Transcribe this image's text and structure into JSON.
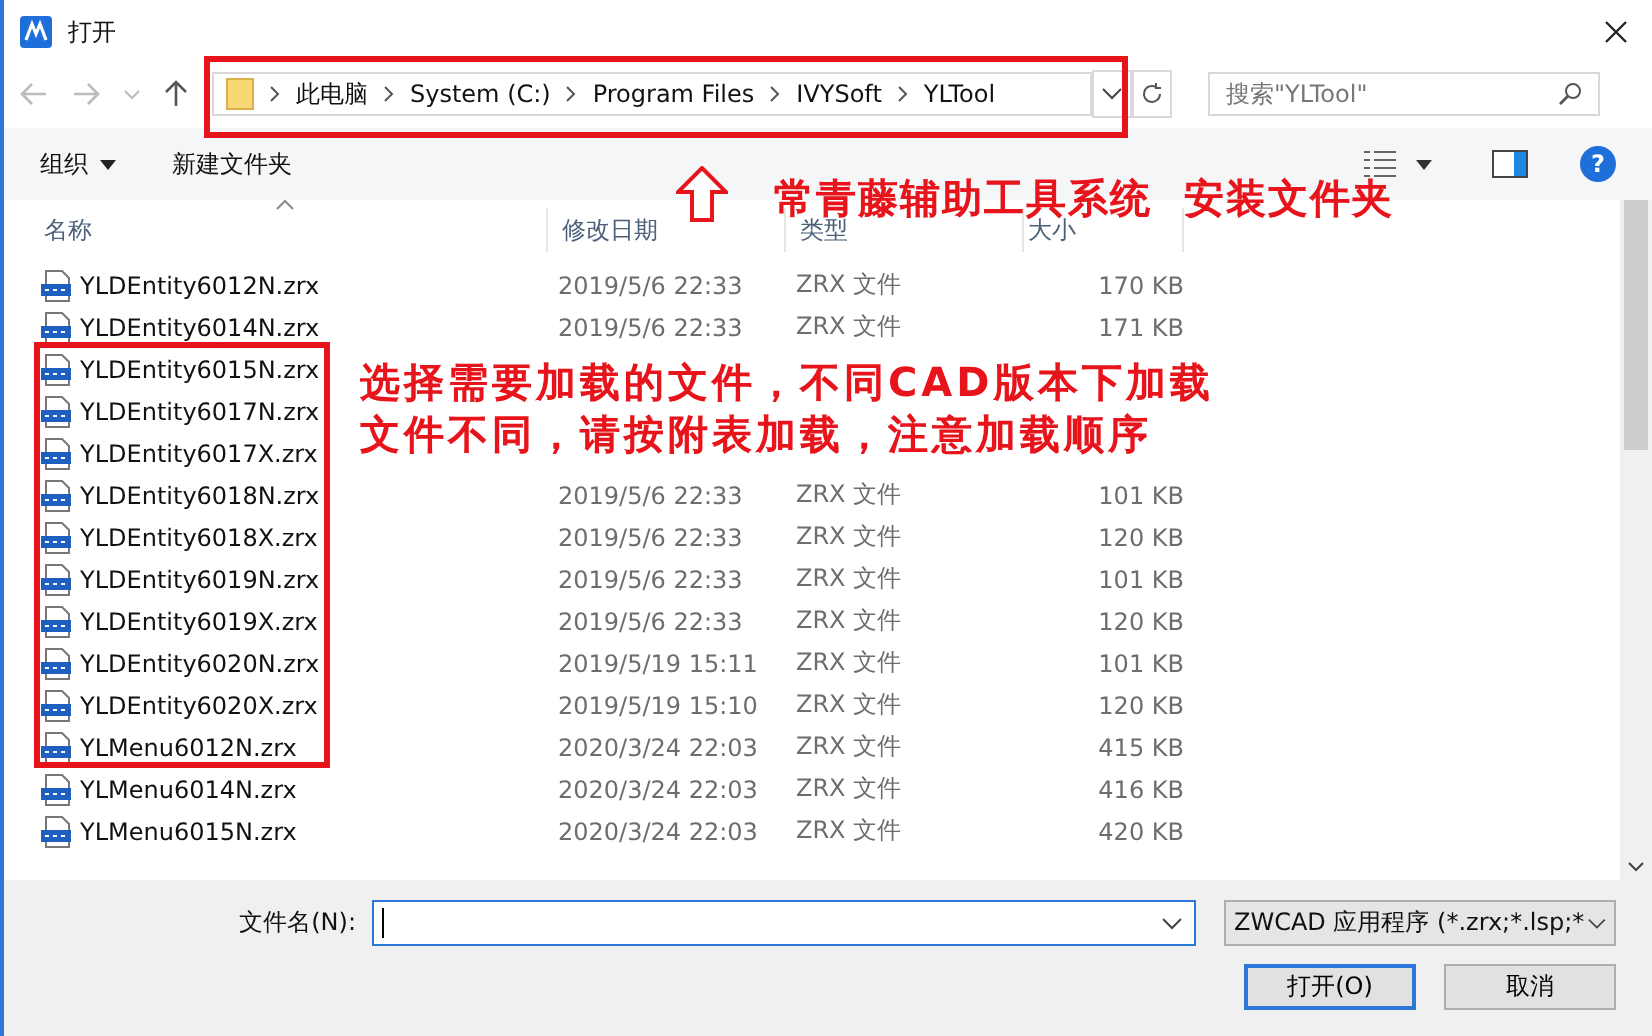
{
  "window": {
    "title": "打开"
  },
  "address_bar": {
    "crumbs": [
      "此电脑",
      "System (C:)",
      "Program Files",
      "IVYSoft",
      "YLTool"
    ]
  },
  "search": {
    "placeholder": "搜索\"YLTool\""
  },
  "toolbar": {
    "organize": "组织",
    "new_folder": "新建文件夹",
    "help": "?"
  },
  "table": {
    "columns": [
      "名称",
      "修改日期",
      "类型",
      "大小"
    ],
    "rows": [
      {
        "name": "YLDEntity6012N.zrx",
        "date": "2019/5/6 22:33",
        "type": "ZRX 文件",
        "size": "170 KB"
      },
      {
        "name": "YLDEntity6014N.zrx",
        "date": "2019/5/6 22:33",
        "type": "ZRX 文件",
        "size": "171 KB"
      },
      {
        "name": "YLDEntity6015N.zrx"
      },
      {
        "name": "YLDEntity6017N.zrx"
      },
      {
        "name": "YLDEntity6017X.zrx"
      },
      {
        "name": "YLDEntity6018N.zrx",
        "date": "2019/5/6 22:33",
        "type": "ZRX 文件",
        "size": "101 KB"
      },
      {
        "name": "YLDEntity6018X.zrx",
        "date": "2019/5/6 22:33",
        "type": "ZRX 文件",
        "size": "120 KB"
      },
      {
        "name": "YLDEntity6019N.zrx",
        "date": "2019/5/6 22:33",
        "type": "ZRX 文件",
        "size": "101 KB"
      },
      {
        "name": "YLDEntity6019X.zrx",
        "date": "2019/5/6 22:33",
        "type": "ZRX 文件",
        "size": "120 KB"
      },
      {
        "name": "YLDEntity6020N.zrx",
        "date": "2019/5/19 15:11",
        "type": "ZRX 文件",
        "size": "101 KB"
      },
      {
        "name": "YLDEntity6020X.zrx",
        "date": "2019/5/19 15:10",
        "type": "ZRX 文件",
        "size": "120 KB"
      },
      {
        "name": "YLMenu6012N.zrx",
        "date": "2020/3/24 22:03",
        "type": "ZRX 文件",
        "size": "415 KB"
      },
      {
        "name": "YLMenu6014N.zrx",
        "date": "2020/3/24 22:03",
        "type": "ZRX 文件",
        "size": "416 KB"
      },
      {
        "name": "YLMenu6015N.zrx",
        "date": "2020/3/24 22:03",
        "type": "ZRX 文件",
        "size": "420 KB"
      }
    ]
  },
  "filename": {
    "label": "文件名(N):"
  },
  "filter": {
    "value": "ZWCAD 应用程序 (*.zrx;*.lsp;*"
  },
  "buttons": [
    {
      "label": "打开(O)",
      "default": true
    },
    {
      "label": "取消",
      "default": false
    }
  ],
  "annotations": [
    {
      "kind": "note",
      "lines": [
        "常青藤辅助工具系统  安装文件夹"
      ]
    },
    {
      "kind": "note",
      "lines": [
        "选择需要加载的文件，不同CAD版本下加载",
        "文件不同，请按附表加载，注意加载顺序"
      ]
    }
  ]
}
